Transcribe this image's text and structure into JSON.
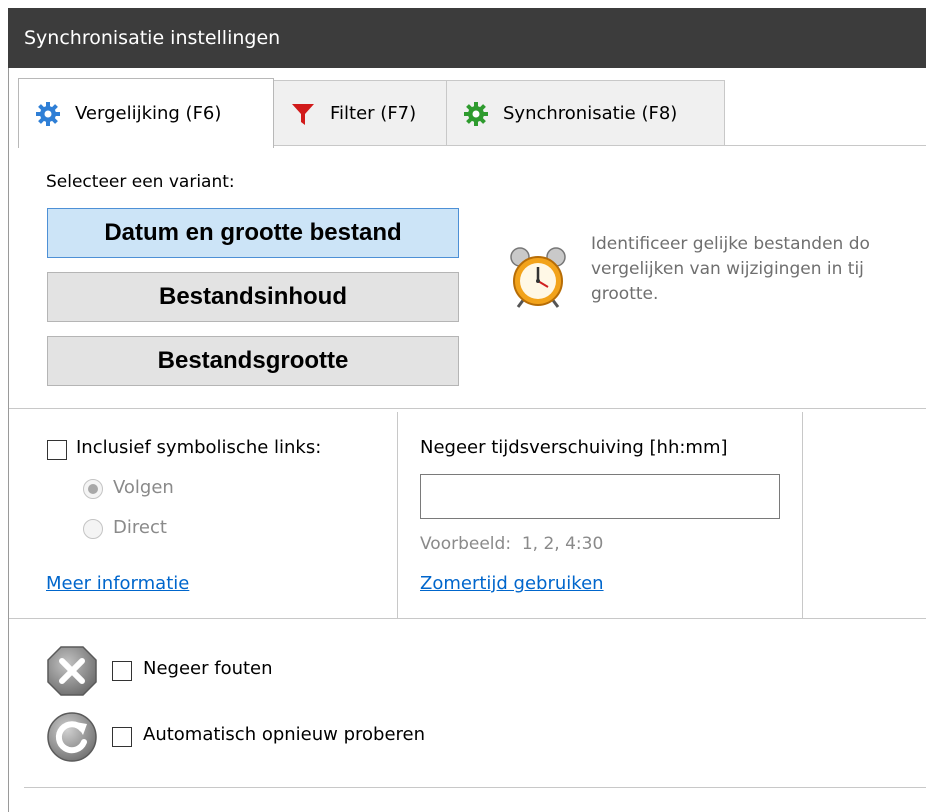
{
  "window": {
    "title": "Synchronisatie instellingen"
  },
  "tabs": [
    {
      "label": "Vergelijking (F6)",
      "icon": "gear-icon",
      "active": true
    },
    {
      "label": "Filter (F7)",
      "icon": "filter-icon",
      "active": false
    },
    {
      "label": "Synchronisatie (F8)",
      "icon": "sync-gear-icon",
      "active": false
    }
  ],
  "compare": {
    "select_label": "Selecteer een variant:",
    "variants": [
      {
        "label": "Datum en grootte bestand",
        "selected": true
      },
      {
        "label": "Bestandsinhoud",
        "selected": false
      },
      {
        "label": "Bestandsgrootte",
        "selected": false
      }
    ],
    "description": "Identificeer gelijke bestanden do\nvergelijken van wijzigingen in tij\ngrootte.",
    "description_icon": "alarm-clock-icon"
  },
  "symlinks": {
    "checkbox_label": "Inclusief symbolische links:",
    "checked": false,
    "options": [
      {
        "label": "Volgen",
        "selected": true
      },
      {
        "label": "Direct",
        "selected": false
      }
    ],
    "more_info_link": "Meer informatie"
  },
  "timeshift": {
    "label": "Negeer tijdsverschuiving [hh:mm]",
    "value": "",
    "example": "Voorbeeld:  1, 2, 4:30",
    "dst_link": "Zomertijd gebruiken"
  },
  "errors": {
    "ignore_label": "Negeer fouten",
    "ignore_checked": false,
    "ignore_icon": "error-x-icon",
    "retry_label": "Automatisch opnieuw proberen",
    "retry_checked": false,
    "retry_icon": "retry-icon"
  },
  "colors": {
    "titlebar": "#3c3c3c",
    "selected_variant": "#cce4f7",
    "link": "#0066cc"
  }
}
